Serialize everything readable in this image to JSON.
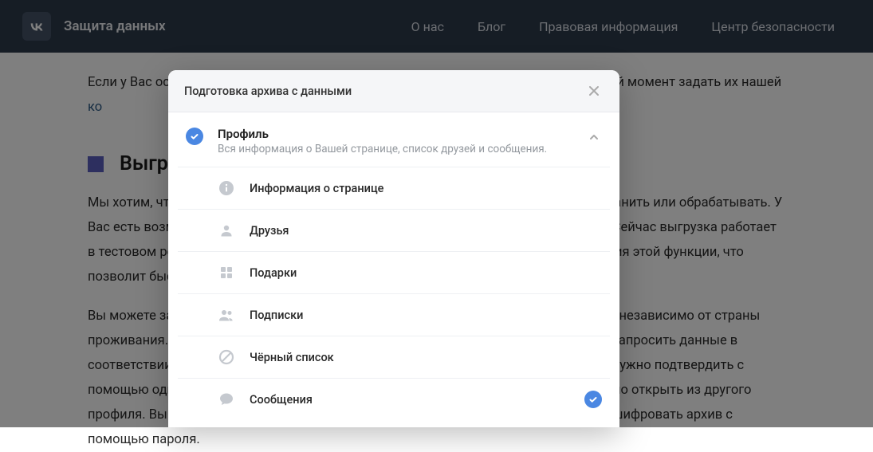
{
  "header": {
    "brand": "Защита данных",
    "nav": {
      "about": "О нас",
      "blog": "Блог",
      "legal": "Правовая информация",
      "safety": "Центр безопасности"
    }
  },
  "page": {
    "intro": "Если у Вас остались вопросы касательно приватности ВКонтакте, Вы можете в любой момент задать их нашей ",
    "intro_link": "ко",
    "heading": "Выгрузить",
    "p1": "Мы хотим, чтобы архив содержал информацию и сообщения, которую Вы можете хранить или обрабатывать. У Вас есть возможность выбрать информацию и сообщения для сохранения в архив. Сейчас выгрузка работает в тестовом режиме, мы принимаем предложения по улучшению и совершенствования этой функции, что позволит быстро создавать архив данных.",
    "p2": "Вы можете запросить архив данных из своего профиля в любое время и с любого IP, независимо от страны проживания. Процесс подготовки архива и скачивания защищён. Чтобы безопасно запросить данные в соответствии с законодательством о защите данных, личность пользователя будет нужно подтвердить с помощью одного из доступных способов, а ссылку на скачивание архива невозможно открыть из другого профиля. Вы можете добавить дополнительный уровень защиты — возможность зашифровать архив с помощью пароля."
  },
  "modal": {
    "title": "Подготовка архива с данными",
    "cat_title": "Профиль",
    "cat_desc": "Вся информация о Вашей странице, список друзей и сообщения.",
    "opts": {
      "info": "Информация о странице",
      "friends": "Друзья",
      "gifts": "Подарки",
      "subs": "Подписки",
      "blacklist": "Чёрный список",
      "messages": "Сообщения"
    }
  }
}
